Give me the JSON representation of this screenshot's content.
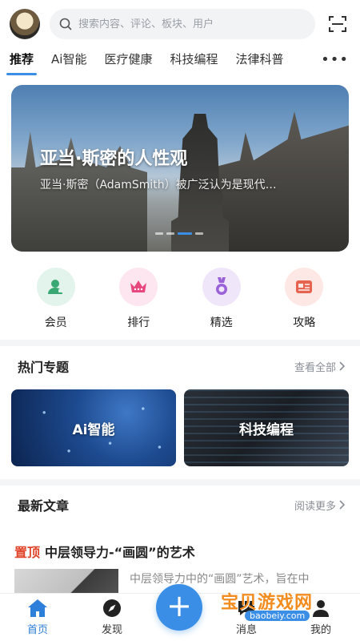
{
  "header": {
    "search_placeholder": "搜索内容、评论、板块、用户"
  },
  "tabs": [
    {
      "label": "推荐"
    },
    {
      "label": "Ai智能"
    },
    {
      "label": "医疗健康"
    },
    {
      "label": "科技编程"
    },
    {
      "label": "法律科普"
    }
  ],
  "tab_more": "•••",
  "banner": {
    "title": "亚当·斯密的人性观",
    "subtitle": "亚当·斯密（AdamSmith）被广泛认为是现代…"
  },
  "quick_nav": [
    {
      "label": "会员",
      "icon": "member-icon",
      "bg": "#e3f4ec",
      "color": "#3aa872"
    },
    {
      "label": "排行",
      "icon": "crown-icon",
      "bg": "#fde6ef",
      "color": "#e8477d"
    },
    {
      "label": "精选",
      "icon": "medal-icon",
      "bg": "#efe6fa",
      "color": "#9b62d8"
    },
    {
      "label": "攻略",
      "icon": "guide-icon",
      "bg": "#fde8e6",
      "color": "#e6644f"
    }
  ],
  "hot_topics": {
    "title": "热门专题",
    "more": "查看全部",
    "items": [
      {
        "label": "Ai智能"
      },
      {
        "label": "科技编程"
      }
    ]
  },
  "latest": {
    "title": "最新文章",
    "more": "阅读更多",
    "article": {
      "pin": "置顶",
      "title": "中层领导力-“画圆”的艺术",
      "excerpt": "中层领导力中的“画圆”艺术，旨在中"
    }
  },
  "bottom_nav": {
    "home": "首页",
    "discover": "发现",
    "add": "+",
    "messages": "消息",
    "mine": "我的"
  },
  "watermark": {
    "text": "宝贝游戏网",
    "url": "baobeiy.com"
  },
  "colors": {
    "accent": "#3a8ee6",
    "pin": "#e0452b"
  }
}
